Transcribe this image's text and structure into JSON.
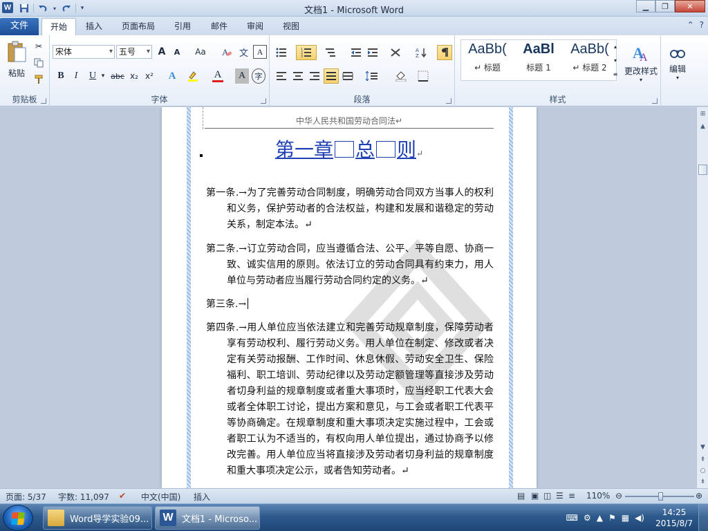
{
  "window": {
    "title": "文档1 - Microsoft Word",
    "app_icon": "W"
  },
  "quick_access": {
    "save_icon": "save-icon",
    "undo_icon": "undo-icon",
    "redo_icon": "redo-icon",
    "customize_icon": "customize-qat-icon"
  },
  "tabs": {
    "file": "文件",
    "home": "开始",
    "insert": "插入",
    "page_layout": "页面布局",
    "references": "引用",
    "mailings": "邮件",
    "review": "审阅",
    "view": "视图",
    "active": "开始"
  },
  "ribbon": {
    "clipboard": {
      "paste_label": "粘贴",
      "group_label": "剪贴板"
    },
    "font": {
      "font_name": "宋体",
      "font_size": "五号",
      "change_case": "Aa",
      "group_label": "字体",
      "bold": "B",
      "italic": "I",
      "underline": "U",
      "strike": "abc",
      "subscript": "x₂",
      "superscript": "x²",
      "text_effect": "A",
      "font_color": "A",
      "char_shading": "A",
      "grow": "A",
      "shrink": "A",
      "clear_format": "A",
      "enclose": "字"
    },
    "paragraph": {
      "group_label": "段落"
    },
    "styles": {
      "group_label": "样式",
      "items": [
        {
          "sample": "AaBb(",
          "name": "↵ 标题"
        },
        {
          "sample": "AaBl",
          "name": "标题 1"
        },
        {
          "sample": "AaBb(",
          "name": "↵ 标题 2"
        }
      ],
      "change_styles": "更改样式"
    },
    "editing": {
      "label": "编辑"
    }
  },
  "document": {
    "header_text": "中华人民共和国劳动合同法↵",
    "chapter_pre": "第一章",
    "chapter_mid": "总",
    "chapter_post": "则",
    "chapter_mark": "↵",
    "paragraphs": [
      {
        "label": "第一条.",
        "text": "→为了完善劳动合同制度，明确劳动合同双方当事人的权利和义务，保护劳动者的合法权益，构建和发展和谐稳定的劳动关系，制定本法。↵"
      },
      {
        "label": "第二条.",
        "text": "→订立劳动合同，应当遵循合法、公平、平等自愿、协商一致、诚实信用的原则。依法订立的劳动合同具有约束力，用人单位与劳动者应当履行劳动合同约定的义务。↵"
      },
      {
        "label": "第三条.",
        "text": "→"
      },
      {
        "label": "第四条.",
        "text": "→用人单位应当依法建立和完善劳动规章制度，保障劳动者享有劳动权利、履行劳动义务。用人单位在制定、修改或者决定有关劳动报酬、工作时间、休息休假、劳动安全卫生、保险福利、职工培训、劳动纪律以及劳动定额管理等直接涉及劳动者切身利益的规章制度或者重大事项时，应当经职工代表大会或者全体职工讨论，提出方案和意见，与工会或者职工代表平等协商确定。在规章制度和重大事项决定实施过程中，工会或者职工认为不适当的，有权向用人单位提出，通过协商予以修改完善。用人单位应当将直接涉及劳动者切身利益的规章制度和重大事项决定公示，或者告知劳动者。↵"
      }
    ]
  },
  "statusbar": {
    "page": "页面: 5/37",
    "words": "字数: 11,097",
    "language": "中文(中国)",
    "mode": "插入",
    "zoom": "110%",
    "zoom_level": 110
  },
  "taskbar": {
    "items": [
      {
        "label": "Word导学实验09...",
        "active": false
      },
      {
        "label": "文档1 - Microso...",
        "active": true
      }
    ],
    "time": "14:25",
    "date": "2015/8/7"
  },
  "colors": {
    "accent": "#2b5797",
    "chapter": "#1f3fb4",
    "file_tab": "#2a5fa8"
  }
}
